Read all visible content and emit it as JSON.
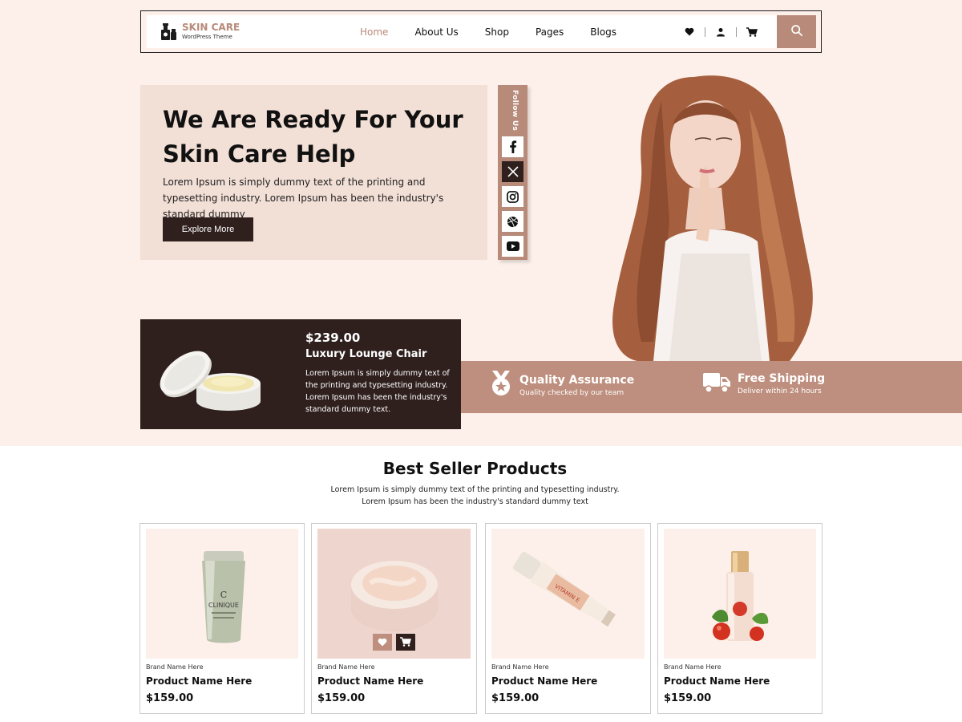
{
  "brand": {
    "title": "SKIN CARE",
    "subtitle": "WordPress Theme"
  },
  "nav": {
    "items": [
      {
        "label": "Home"
      },
      {
        "label": "About Us"
      },
      {
        "label": "Shop"
      },
      {
        "label": "Pages"
      },
      {
        "label": "Blogs"
      }
    ]
  },
  "header_icons": [
    "heart-icon",
    "user-icon",
    "cart-icon",
    "search-icon"
  ],
  "hero": {
    "title": "We Are Ready For Your Skin Care Help",
    "text": "Lorem Ipsum is simply dummy text of the printing and typesetting industry. Lorem Ipsum has been the industry's standard dummy",
    "button": "Explore More"
  },
  "follow": {
    "label": "Follow Us",
    "icons": [
      "facebook-icon",
      "x-twitter-icon",
      "instagram-icon",
      "dribbble-icon",
      "youtube-icon"
    ]
  },
  "featured_product": {
    "price": "$239.00",
    "name": "Luxury Lounge Chair",
    "text": "Lorem Ipsum is simply dummy text of the printing and typesetting industry. Lorem Ipsum has been the industry's standard dummy text."
  },
  "features": [
    {
      "title": "Quality Assurance",
      "subtitle": "Quality checked by our team",
      "icon": "medal-icon"
    },
    {
      "title": "Free Shipping",
      "subtitle": "Deliver within 24 hours",
      "icon": "truck-icon"
    }
  ],
  "best_seller": {
    "title": "Best Seller Products",
    "subtitle_line1": "Lorem Ipsum is simply dummy text of the printing and typesetting industry.",
    "subtitle_line2": "Lorem Ipsum has been the industry's standard dummy text"
  },
  "products": [
    {
      "brand": "Brand Name Here",
      "name": "Product Name Here",
      "price": "$159.00"
    },
    {
      "brand": "Brand Name Here",
      "name": "Product Name Here",
      "price": "$159.00"
    },
    {
      "brand": "Brand Name Here",
      "name": "Product Name Here",
      "price": "$159.00"
    },
    {
      "brand": "Brand Name Here",
      "name": "Product Name Here",
      "price": "$159.00"
    }
  ],
  "product_image_labels": {
    "tube": "CLINIQUE",
    "vitamin": "VITAMIN E"
  },
  "colors": {
    "accent": "#b88a79",
    "dark": "#2f201e",
    "hero_bg": "#fdf0ea",
    "hero_box": "#f2dfd6"
  }
}
